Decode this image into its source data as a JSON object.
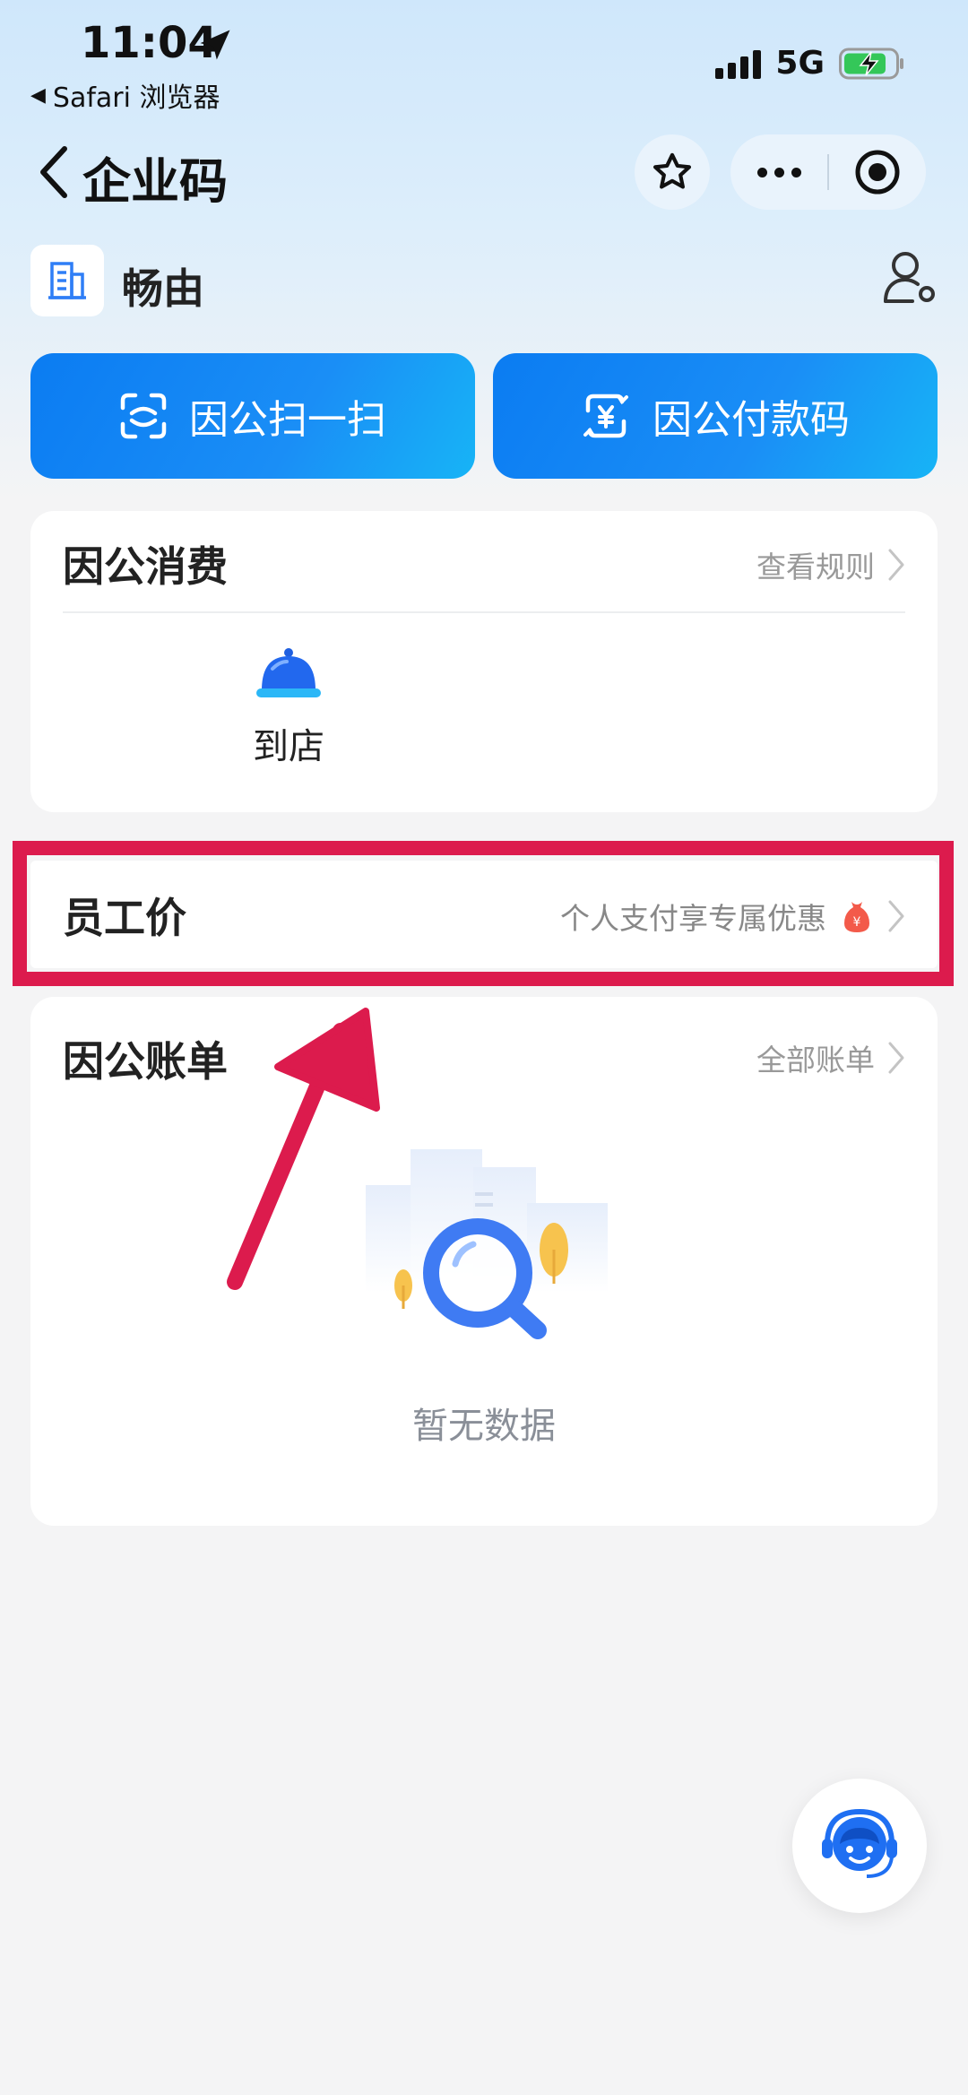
{
  "status_bar": {
    "time": "11:04",
    "back_app": "Safari 浏览器",
    "network": "5G"
  },
  "nav": {
    "title": "企业码"
  },
  "company": {
    "name": "畅由"
  },
  "actions": {
    "scan_label": "因公扫一扫",
    "pay_code_label": "因公付款码"
  },
  "consume": {
    "title": "因公消费",
    "rules_link": "查看规则",
    "items": [
      {
        "label": "到店",
        "icon": "service-bell-icon"
      }
    ]
  },
  "employee_price": {
    "title": "员工价",
    "subtitle": "个人支付享专属优惠",
    "badge_icon": "money-bag-icon"
  },
  "bills": {
    "title": "因公账单",
    "all_link": "全部账单",
    "empty_text": "暂无数据"
  },
  "colors": {
    "primary_blue": "#1a8ef6",
    "highlight_red": "#dc1b4d",
    "background": "#f4f4f5"
  }
}
